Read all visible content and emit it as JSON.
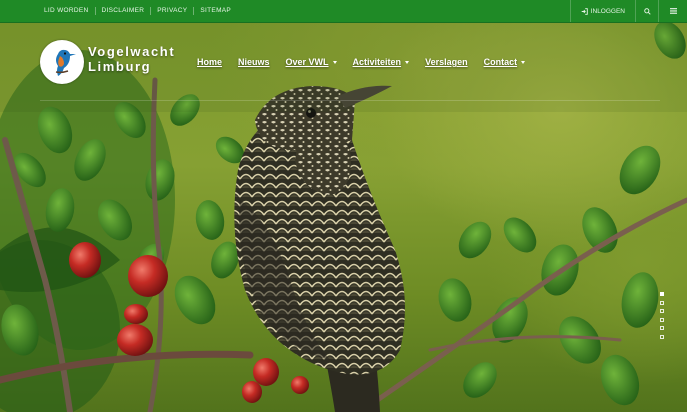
{
  "topbar": {
    "links": [
      "LID WORDEN",
      "DISCLAIMER",
      "PRIVACY",
      "SITEMAP"
    ],
    "login_label": "INLOGGEN",
    "search_icon": "search-icon",
    "menu_icon": "hamburger-menu-icon"
  },
  "brand": {
    "line1": "Vogelwacht",
    "line2": "Limburg"
  },
  "nav": {
    "items": [
      {
        "label": "Home",
        "dropdown": false
      },
      {
        "label": "Nieuws",
        "dropdown": false
      },
      {
        "label": "Over VWL",
        "dropdown": true
      },
      {
        "label": "Activiteiten",
        "dropdown": true
      },
      {
        "label": "Verslagen",
        "dropdown": false
      },
      {
        "label": "Contact",
        "dropdown": true
      }
    ]
  },
  "slider": {
    "slide_count": 6,
    "active_index": 0
  },
  "colors": {
    "topbar": "#1f8a26",
    "nav_text": "#ffffff"
  }
}
